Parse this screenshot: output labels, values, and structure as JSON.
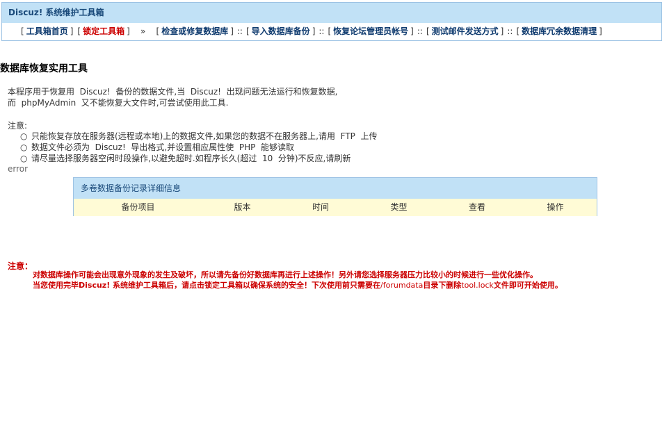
{
  "header": {
    "title": "Discuz! 系统维护工具箱"
  },
  "nav": {
    "items": [
      {
        "label": "工具箱首页",
        "red": false
      },
      {
        "label": "锁定工具箱",
        "red": true
      },
      {
        "label": "检查或修复数据库",
        "red": false
      },
      {
        "label": "导入数据库备份",
        "red": false
      },
      {
        "label": "恢复论坛管理员帐号",
        "red": false
      },
      {
        "label": "测试邮件发送方式",
        "red": false
      },
      {
        "label": "数据库冗余数据清理",
        "red": false
      }
    ],
    "raquo": "»",
    "separator": "::",
    "open_bracket": "[",
    "close_bracket": "]"
  },
  "main": {
    "page_title": "数据库恢复实用工具",
    "intro_line1": "本程序用于恢复用  Discuz!  备份的数据文件,当  Discuz!  出现问题无法运行和恢复数据,",
    "intro_line2": "而  phpMyAdmin  又不能恢复大文件时,可尝试使用此工具.",
    "notes_label": "注意:",
    "notes": [
      "只能恢复存放在服务器(远程或本地)上的数据文件,如果您的数据不在服务器上,请用  FTP  上传",
      "数据文件必须为  Discuz!  导出格式,并设置相应属性使  PHP  能够读取",
      "请尽量选择服务器空闲时段操作,以避免超时.如程序长久(超过  10  分钟)不反应,请刷新"
    ],
    "bullet": "○",
    "error": "error"
  },
  "backup_table": {
    "title": "多卷数据备份记录详细信息",
    "columns": [
      "备份项目",
      "版本",
      "时间",
      "类型",
      "查看",
      "操作"
    ]
  },
  "warning": {
    "label": "注意：",
    "line1": "对数据库操作可能会出现意外现象的发生及破坏，所以请先备份好数据库再进行上述操作！另外请您选择服务器压力比较小的时候进行一些优化操作。",
    "line2_a": "当您使用完毕Discuz! 系统维护工具箱后，请点击锁定工具箱以确保系统的安全！下次使用前只需要在",
    "line2_path": "/forumdata",
    "line2_b": "目录下删除",
    "line2_file": "tool.lock",
    "line2_c": "文件即可开始使用。"
  },
  "colors": {
    "header_bg": "#c1e1f6",
    "border": "#9dc3e4",
    "link": "#0e3a6e",
    "red": "#cc0000",
    "table_cols_bg": "#fffbd6"
  }
}
